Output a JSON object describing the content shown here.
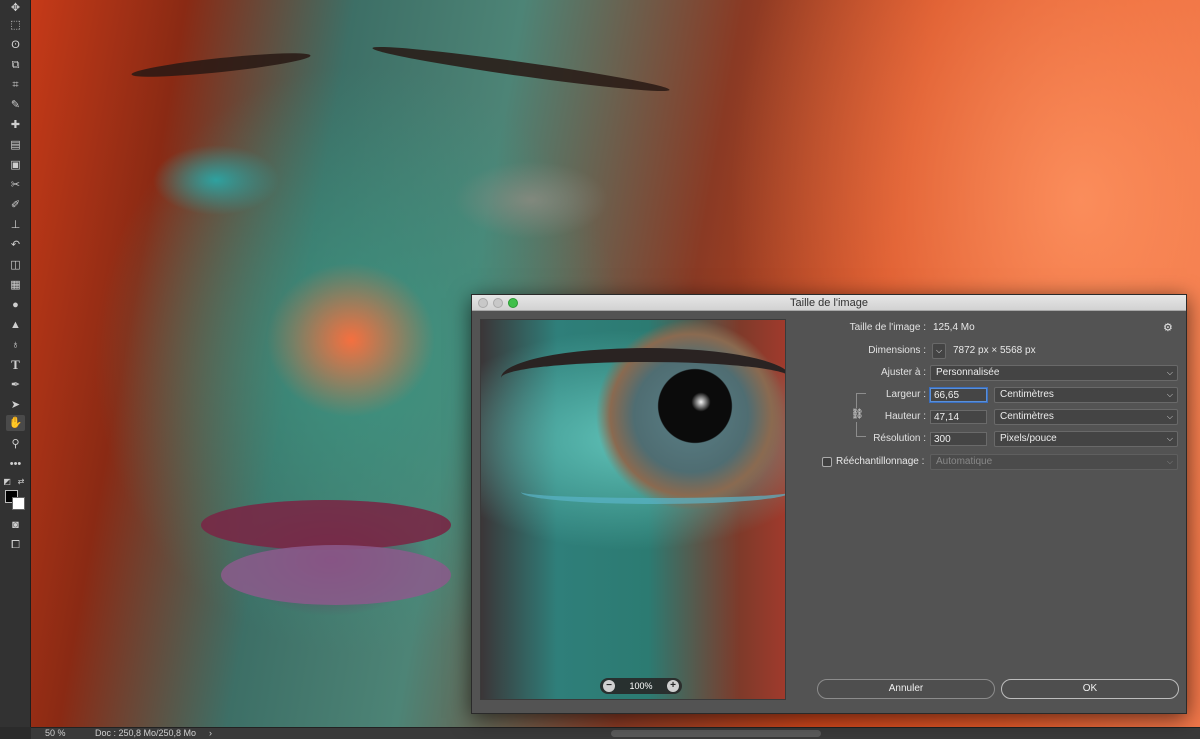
{
  "status": {
    "zoom": "50 %",
    "doc": "Doc : 250,8 Mo/250,8 Mo",
    "arrow": "›"
  },
  "dialog": {
    "title": "Taille de l'image",
    "image_size_label": "Taille de l'image :",
    "image_size_value": "125,4 Mo",
    "dimensions_label": "Dimensions :",
    "dimensions_value": "7872 px  ×  5568 px",
    "fit_label": "Ajuster à :",
    "fit_value": "Personnalisée",
    "width_label": "Largeur :",
    "width_value": "66,65",
    "width_unit": "Centimètres",
    "height_label": "Hauteur :",
    "height_value": "47,14",
    "height_unit": "Centimètres",
    "resolution_label": "Résolution :",
    "resolution_value": "300",
    "resolution_unit": "Pixels/pouce",
    "resample_label": "Rééchantillonnage :",
    "resample_value": "Automatique",
    "preview_zoom": "100%",
    "cancel_label": "Annuler",
    "ok_label": "OK"
  },
  "colors": {
    "accent_focus": "#5a8fd8",
    "traffic_close": "#c8c8c8",
    "traffic_min": "#c8c8c8",
    "traffic_max": "#3fbf4a"
  },
  "icons": {
    "tools": [
      "move-icon",
      "marquee-icon",
      "lasso-icon",
      "object-select-icon",
      "crop-icon",
      "eyedropper-icon",
      "healing-brush-icon",
      "patch-icon",
      "frame-icon",
      "content-aware-icon",
      "brush-icon",
      "stamp-icon",
      "history-brush-icon",
      "eraser-icon",
      "gradient-icon",
      "blur-icon",
      "sharpen-icon",
      "dodge-icon",
      "type-icon",
      "pen-icon",
      "path-select-icon",
      "hand-icon",
      "zoom-icon",
      "more-tools-icon"
    ]
  }
}
